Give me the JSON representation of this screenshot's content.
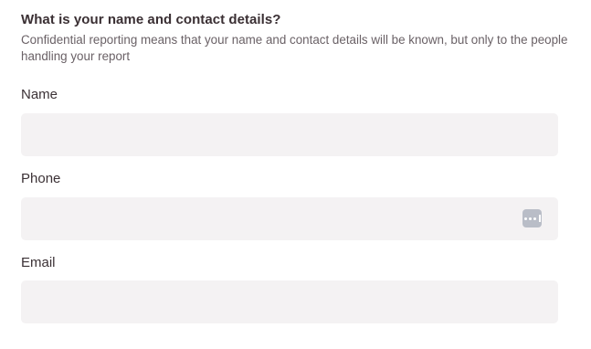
{
  "section": {
    "heading": "What is your name and contact details?",
    "description": "Confidential reporting means that your name and contact details will be known, but only to the people handling your report"
  },
  "fields": {
    "name": {
      "label": "Name",
      "value": "",
      "placeholder": ""
    },
    "phone": {
      "label": "Phone",
      "value": "",
      "placeholder": "",
      "autofill_icon": "password-manager-icon"
    },
    "email": {
      "label": "Email",
      "value": "",
      "placeholder": ""
    }
  }
}
